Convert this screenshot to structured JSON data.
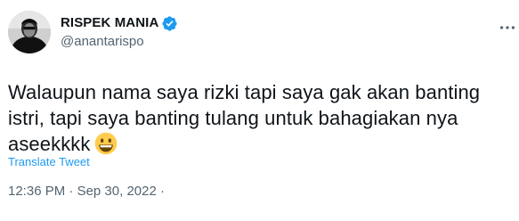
{
  "author": {
    "display_name": "RISPEK MANIA",
    "handle": "@anantarispo",
    "verified": true
  },
  "icons": {
    "verified": "verified-badge-icon",
    "more": "more-options-icon",
    "emoji": "grinning-face-emoji"
  },
  "colors": {
    "verified_blue": "#1d9bf0",
    "link_blue": "#1d9bf0",
    "secondary_text": "#536471",
    "primary_text": "#0f1419"
  },
  "tweet": {
    "text": "Walaupun nama saya rizki tapi saya gak akan banting istri, tapi saya banting tulang untuk bahagiakan nya aseekkkk",
    "translate_label": "Translate Tweet",
    "time": "12:36 PM",
    "separator": " · ",
    "date": "Sep 30, 2022",
    "trailing_separator": " ·"
  }
}
